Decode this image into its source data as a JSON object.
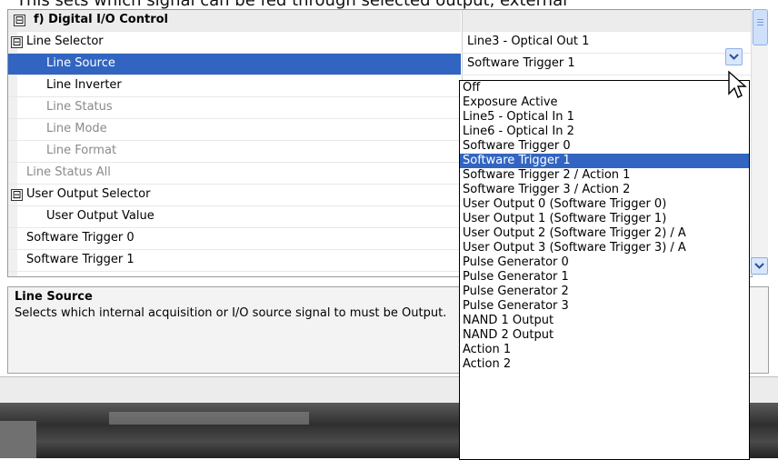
{
  "caption": "This sets which signal can be fed through selected output, external",
  "grid": {
    "rows": [
      {
        "label": "f) Digital I/O Control",
        "value": "",
        "type": "category",
        "expander": "⊟",
        "indent": 0
      },
      {
        "label": "Line Selector",
        "value": "Line3 - Optical Out 1",
        "type": "normal",
        "expander": "⊟",
        "indent": 1
      },
      {
        "label": "Line Source",
        "value": "Software Trigger 1",
        "type": "selected",
        "expander": "",
        "indent": 2
      },
      {
        "label": "Line Inverter",
        "value": "",
        "type": "normal",
        "expander": "",
        "indent": 2
      },
      {
        "label": "Line Status",
        "value": "",
        "type": "dim",
        "expander": "",
        "indent": 2
      },
      {
        "label": "Line Mode",
        "value": "",
        "type": "dim",
        "expander": "",
        "indent": 2
      },
      {
        "label": "Line Format",
        "value": "",
        "type": "dim",
        "expander": "",
        "indent": 2
      },
      {
        "label": "Line Status All",
        "value": "",
        "type": "dim",
        "expander": "",
        "indent": 1
      },
      {
        "label": "User Output Selector",
        "value": "",
        "type": "normal",
        "expander": "⊟",
        "indent": 1
      },
      {
        "label": "User Output Value",
        "value": "",
        "type": "normal",
        "expander": "",
        "indent": 2
      },
      {
        "label": "Software Trigger 0",
        "value": "",
        "type": "normal",
        "expander": "",
        "indent": 1
      },
      {
        "label": "Software Trigger 1",
        "value": "",
        "type": "normal",
        "expander": "",
        "indent": 1
      }
    ]
  },
  "help": {
    "title": "Line Source",
    "description": "Selects which internal acquisition or I/O source signal to must be Output."
  },
  "dropdown": {
    "selected_value": "Software Trigger 1",
    "options": [
      "Off",
      "Exposure Active",
      "Line5 - Optical In 1",
      "Line6 - Optical In 2",
      "Software Trigger 0",
      "Software Trigger 1",
      "Software Trigger 2 / Action 1",
      "Software Trigger 3 / Action 2",
      "User Output 0 (Software Trigger 0)",
      "User Output 1 (Software Trigger 1)",
      "User Output 2 (Software Trigger 2) / A",
      "User Output 3 (Software Trigger 3) / A",
      "Pulse Generator 0",
      "Pulse Generator 1",
      "Pulse Generator 2",
      "Pulse Generator 3",
      "NAND 1 Output",
      "NAND 2 Output",
      "Action 1",
      "Action 2"
    ],
    "selected_index": 5
  },
  "colors": {
    "selection": "#3265c1",
    "scroll_accent": "#8fb0e8"
  }
}
